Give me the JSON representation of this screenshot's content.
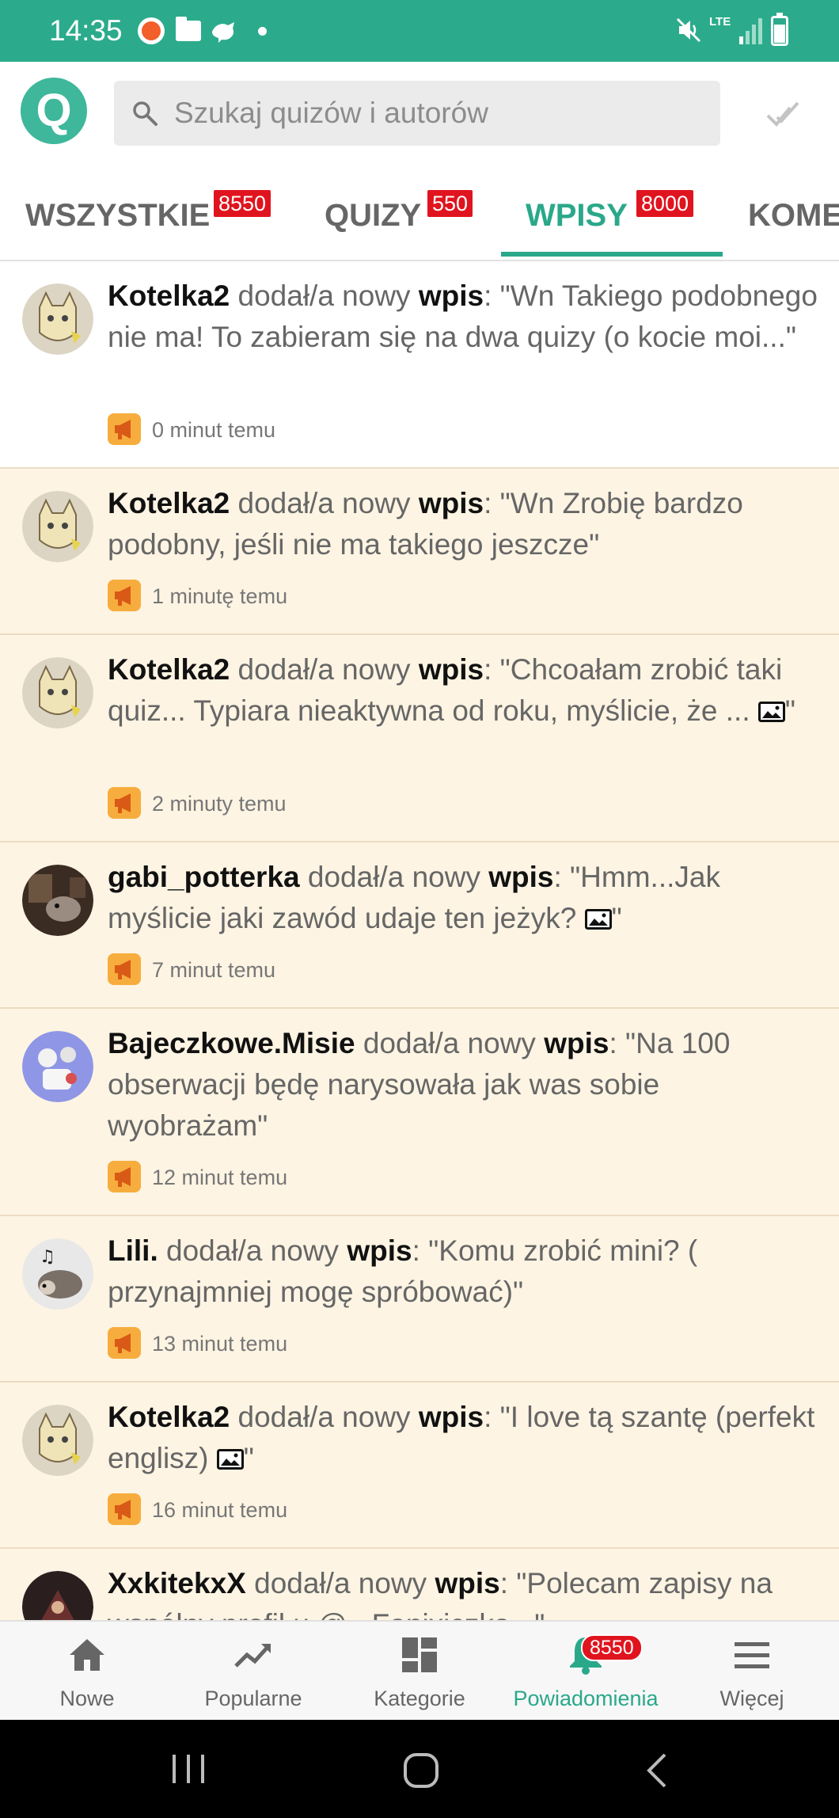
{
  "status_bar": {
    "time": "14:35",
    "network": "LTE"
  },
  "app": {
    "logo_letter": "Q"
  },
  "search": {
    "placeholder": "Szukaj quizów i autorów"
  },
  "tabs": [
    {
      "label": "WSZYSTKIE",
      "badge": "8550",
      "active": false
    },
    {
      "label": "QUIZY",
      "badge": "550",
      "active": false
    },
    {
      "label": "WPISY",
      "badge": "8000",
      "active": true
    },
    {
      "label": "KOME",
      "badge": "",
      "active": false
    }
  ],
  "notifications": [
    {
      "author": "Kotelka2",
      "action": " dodał/a nowy ",
      "keyword": "wpis",
      "colon": ": ",
      "text": "\"Wn Takiego podobnego nie ma! To zabieram się na dwa quizy (o kocie moi...\"",
      "time": "0 minut temu",
      "unread": false,
      "has_image": false
    },
    {
      "author": "Kotelka2",
      "action": " dodał/a nowy ",
      "keyword": "wpis",
      "colon": ": ",
      "text": "\"Wn Zrobię bardzo podobny, jeśli nie ma takiego jeszcze\"",
      "time": "1 minutę temu",
      "unread": true,
      "has_image": false
    },
    {
      "author": "Kotelka2",
      "action": " dodał/a nowy ",
      "keyword": "wpis",
      "colon": ": ",
      "text": "\"Chcoałam zrobić taki quiz... Typiara nieaktywna od roku, myślicie, że ... ",
      "text_end": "\"",
      "time": "2 minuty temu",
      "unread": true,
      "has_image": true
    },
    {
      "author": "gabi_potterka",
      "action": " dodał/a nowy ",
      "keyword": "wpis",
      "colon": ": ",
      "text": "\"Hmm...Jak myślicie jaki zawód udaje ten jeżyk? ",
      "text_end": "\"",
      "time": "7 minut temu",
      "unread": true,
      "has_image": true
    },
    {
      "author": "Bajeczkowe.Misie",
      "action": " dodał/a nowy ",
      "keyword": "wpis",
      "colon": ": ",
      "text": "\"Na 100 obserwacji będę narysowała jak was sobie wyobrażam\"",
      "time": "12 minut temu",
      "unread": true,
      "has_image": false
    },
    {
      "author": "Lili.",
      "action": " dodał/a nowy ",
      "keyword": "wpis",
      "colon": ": ",
      "text": "\"Komu zrobić mini? ( przynajmniej mogę spróbować)\"",
      "time": "13 minut temu",
      "unread": true,
      "has_image": false
    },
    {
      "author": "Kotelka2",
      "action": " dodał/a nowy ",
      "keyword": "wpis",
      "colon": ": ",
      "text": "\"I love tą szantę (perfekt englisz) ",
      "text_end": "\"",
      "time": "16 minut temu",
      "unread": true,
      "has_image": true
    },
    {
      "author": "XxkitekxX",
      "action": " dodał/a nowy ",
      "keyword": "wpis",
      "colon": ": ",
      "text": "\"Polecam zapisy na wspólny profil u @...Fanixiczka...\"",
      "time": "",
      "unread": true,
      "has_image": false
    }
  ],
  "bottom_nav": [
    {
      "label": "Nowe",
      "icon": "home-icon",
      "active": false
    },
    {
      "label": "Popularne",
      "icon": "trending-icon",
      "active": false
    },
    {
      "label": "Kategorie",
      "icon": "grid-icon",
      "active": false
    },
    {
      "label": "Powiadomienia",
      "icon": "bell-icon",
      "active": true,
      "badge": "8550"
    },
    {
      "label": "Więcej",
      "icon": "menu-icon",
      "active": false
    }
  ],
  "colors": {
    "primary": "#2aa88a",
    "status_bar": "#2bab8c",
    "unread_bg": "#fdf4e3",
    "badge": "#e0141e",
    "meta_icon": "#f7ad3d"
  }
}
